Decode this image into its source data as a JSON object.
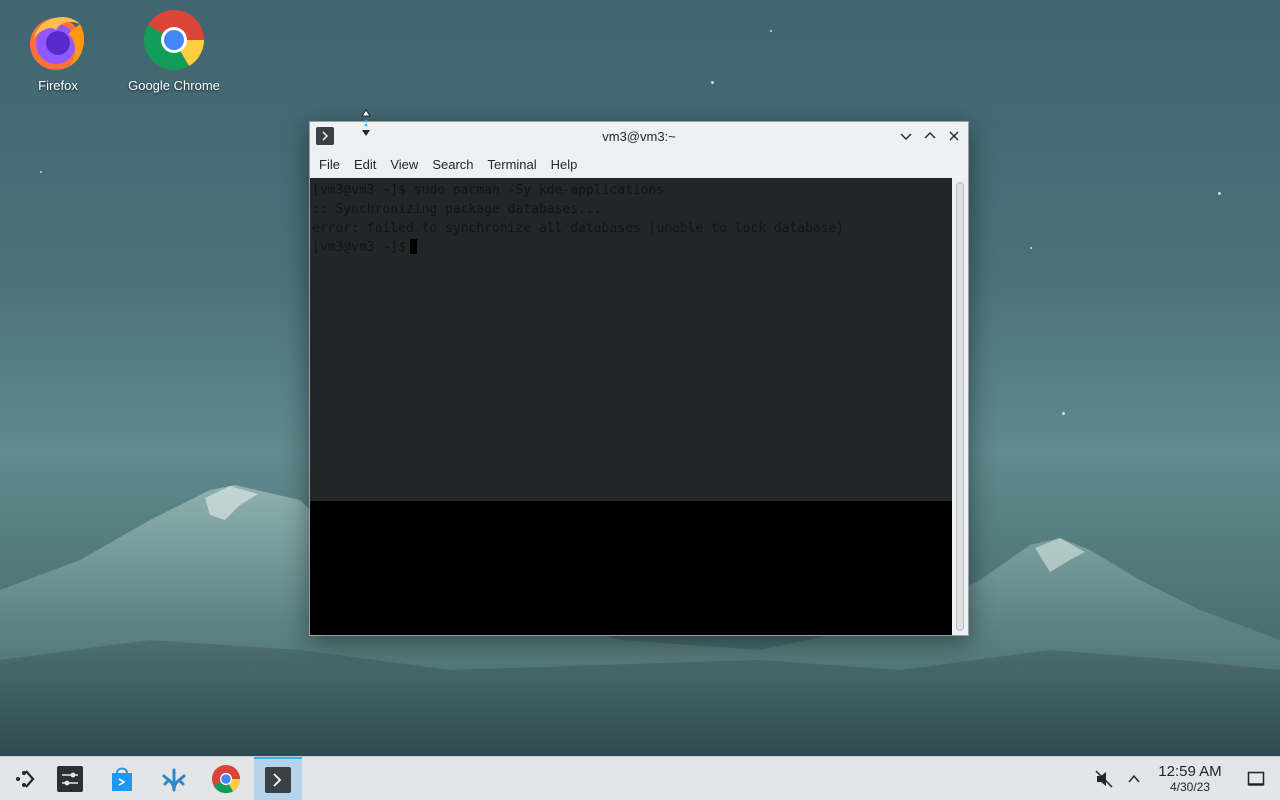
{
  "desktop": {
    "icons": [
      {
        "label": "Firefox"
      },
      {
        "label": "Google Chrome"
      }
    ]
  },
  "window": {
    "title": "vm3@vm3:~",
    "menu": [
      "File",
      "Edit",
      "View",
      "Search",
      "Terminal",
      "Help"
    ],
    "terminal_lines": [
      "[vm3@vm3 ~]$ sudo pacman -Sy kde-applications",
      ":: Synchronizing package databases...",
      "error: failed to synchronize all databases (unable to lock database)",
      "[vm3@vm3 ~]$"
    ]
  },
  "taskbar": {
    "items": [
      "application-launcher-icon",
      "system-settings-icon",
      "discover-icon",
      "plasma-icon",
      "chrome-icon",
      "konsole-icon"
    ],
    "clock_time": "12:59 AM",
    "clock_date": "4/30/23"
  },
  "colors": {
    "accent": "#3daee9",
    "terminal_bg": "#232627"
  }
}
